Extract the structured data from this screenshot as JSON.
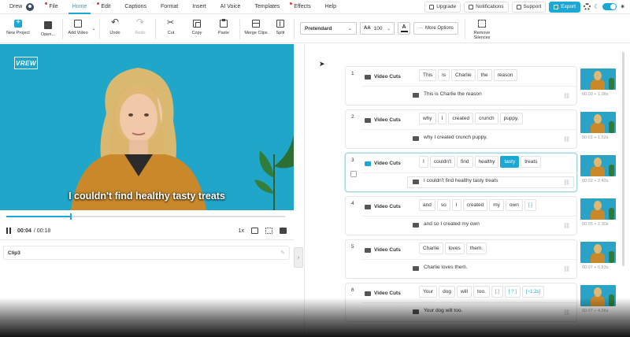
{
  "user": {
    "name": "Drew"
  },
  "menu": [
    {
      "label": "File",
      "dot": true,
      "active": false
    },
    {
      "label": "Home",
      "dot": false,
      "active": true
    },
    {
      "label": "Edit",
      "dot": true,
      "active": false
    },
    {
      "label": "Captions",
      "dot": false,
      "active": false
    },
    {
      "label": "Format",
      "dot": false,
      "active": false
    },
    {
      "label": "Insert",
      "dot": false,
      "active": false
    },
    {
      "label": "AI Voice",
      "dot": false,
      "active": false
    },
    {
      "label": "Templates",
      "dot": false,
      "active": false
    },
    {
      "label": "Effects",
      "dot": true,
      "active": false
    },
    {
      "label": "Help",
      "dot": false,
      "active": false
    }
  ],
  "topright": {
    "upgrade": "Upgrade",
    "notifications": "Notifications",
    "support": "Support",
    "export": "Export"
  },
  "toolbar": {
    "new_project": "New Project",
    "open": "Open...",
    "add_video": "Add Video",
    "undo": "Undo",
    "redo": "Redo",
    "cut": "Cut",
    "copy": "Copy",
    "paste": "Paste",
    "merge_clips": "Merge Clips",
    "split": "Split",
    "font": "Pretendard",
    "font_size": "100",
    "color_letter": "A",
    "more_options": "More Options",
    "remove_silences_1": "Remove",
    "remove_silences_2": "Silences"
  },
  "player": {
    "logo": "VREW",
    "caption": "I couldn't find healthy tasty treats",
    "current_time": "00:04",
    "total_time": "/ 00:18",
    "progress": 0.23,
    "speed": "1x"
  },
  "clip": {
    "name": "Clip3"
  },
  "rows": [
    {
      "num": "1",
      "label": "Video Cuts",
      "words": [
        "This",
        "is",
        "Charlie",
        "the",
        "reason"
      ],
      "highlight": -1,
      "subtitle": "This is Charlie the reason",
      "time": "00:00 + 1.08s",
      "selected": false
    },
    {
      "num": "2",
      "label": "Video Cuts",
      "words": [
        "why",
        "I",
        "created",
        "crunch",
        "puppy,"
      ],
      "highlight": -1,
      "subtitle": "why I created crunch puppy,",
      "time": "00:01 + 1.52s",
      "selected": false
    },
    {
      "num": "3",
      "label": "Video Cuts",
      "words": [
        "I",
        "couldn't",
        "find",
        "healthy",
        "tasty",
        "treats"
      ],
      "highlight": 4,
      "subtitle": "I couldn't find healthy tasty treats",
      "time": "00:02 + 2.42s",
      "selected": true
    },
    {
      "num": "4",
      "label": "Video Cuts",
      "words": [
        "and",
        "so",
        "I",
        "created",
        "my",
        "own",
        "[.]"
      ],
      "highlight": -1,
      "subtitle": "and so I created my own",
      "time": "00:05 + 2.30s",
      "selected": false
    },
    {
      "num": "5",
      "label": "Video Cuts",
      "words": [
        "Charlie",
        "loves",
        "them."
      ],
      "highlight": -1,
      "subtitle": "Charlie loves them.",
      "time": "00:07 + 0.53s",
      "selected": false
    },
    {
      "num": "6",
      "label": "Video Cuts",
      "words": [
        "Your",
        "dog",
        "will",
        "too.",
        "[.]",
        "[ ? ]",
        "[~1.2s]"
      ],
      "highlight": -1,
      "subtitle": "Your dog will too.",
      "time": "00:07 + 4.56s",
      "selected": false
    }
  ]
}
